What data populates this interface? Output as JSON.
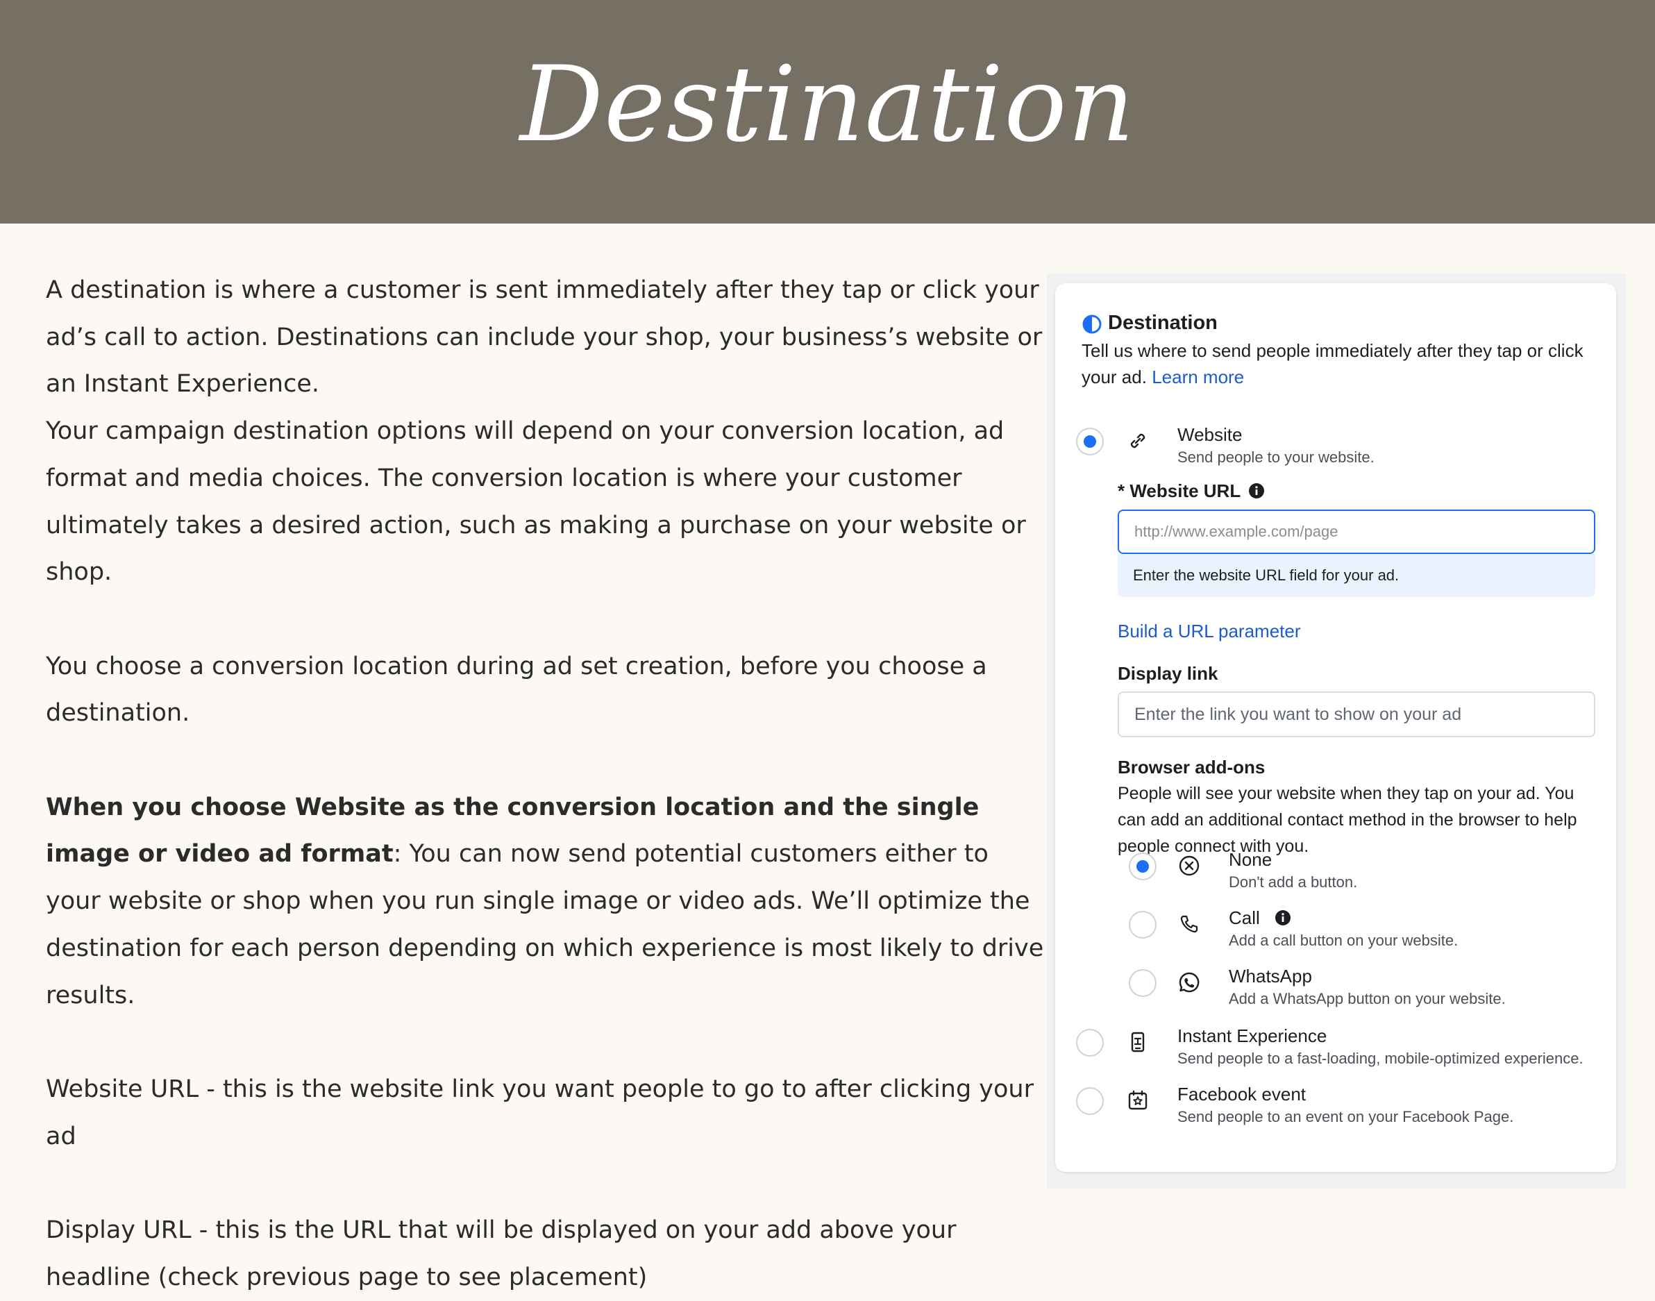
{
  "header": {
    "title": "Destination"
  },
  "body": {
    "p1": "A destination is where a customer is sent immediately after they tap or click your ad’s call to action. Destinations can include your shop, your business’s website or an Instant Experience.",
    "p2": "Your campaign destination options will depend on your conversion location, ad format and media choices. The conversion location is where your customer ultimately takes a desired action, such as making a purchase on your website or shop.",
    "p3": "You choose a conversion location during ad set creation, before you choose a destination.",
    "p4_bold": "When you choose Website as the conversion location and the single image or video ad format",
    "p4_rest": ": You can now send potential customers either to your website or shop when you run single image or video ads. We’ll optimize the destination for each person depending on which experience is most likely to drive results.",
    "p5": "Website URL - this is the website link you want people to go to after clicking your ad",
    "p6": "Display URL - this is the URL that will be displayed on your add above your headline (check previous page to see placement)"
  },
  "panel": {
    "title": "Destination",
    "description": "Tell us where to send people immediately after they tap or click your ad.",
    "learn_more": "Learn more",
    "options": {
      "website": {
        "label": "Website",
        "sub": "Send people to your website.",
        "selected": true
      },
      "instant": {
        "label": "Instant Experience",
        "sub": "Send people to a fast-loading, mobile-optimized experience.",
        "selected": false
      },
      "event": {
        "label": "Facebook event",
        "sub": "Send people to an event on your Facebook Page.",
        "selected": false
      }
    },
    "website_url": {
      "label": "* Website URL",
      "placeholder": "http://www.example.com/page",
      "hint": "Enter the website URL field for your ad."
    },
    "build_url_link": "Build a URL parameter",
    "display_link": {
      "label": "Display link",
      "placeholder": "Enter the link you want to show on your ad"
    },
    "browser_addons": {
      "label": "Browser add-ons",
      "description": "People will see your website when they tap on your ad. You can add an additional contact method in the browser to help people connect with you.",
      "options": {
        "none": {
          "label": "None",
          "sub": "Don't add a button.",
          "selected": true
        },
        "call": {
          "label": "Call",
          "sub": "Add a call button on your website.",
          "selected": false
        },
        "whatsapp": {
          "label": "WhatsApp",
          "sub": "Add a WhatsApp button on your website.",
          "selected": false
        }
      }
    },
    "colors": {
      "accent": "#1b6ef5",
      "link": "#1a5ccc",
      "header_bg": "#766f64",
      "page_bg": "#fcf8f4"
    }
  }
}
